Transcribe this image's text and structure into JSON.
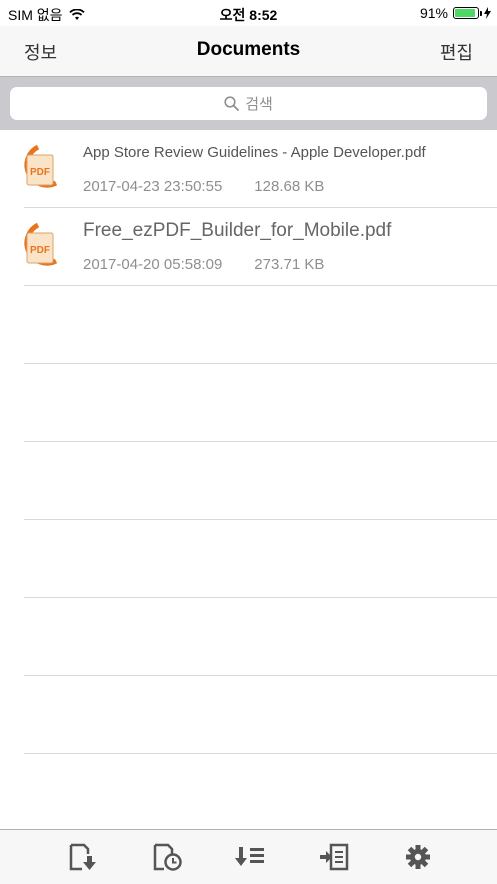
{
  "status": {
    "carrier": "SIM 없음",
    "time": "오전 8:52",
    "battery_percent": "91%",
    "battery_level": 0.91
  },
  "nav": {
    "left": "정보",
    "title": "Documents",
    "right": "편집"
  },
  "search": {
    "placeholder": "검색"
  },
  "files": [
    {
      "name": "App Store Review Guidelines - Apple Developer.pdf",
      "date": "2017-04-23 23:50:55",
      "size": "128.68 KB",
      "icon_text": "PDF"
    },
    {
      "name": "Free_ezPDF_Builder_for_Mobile.pdf",
      "date": "2017-04-20 05:58:09",
      "size": "273.71 KB",
      "icon_text": "PDF"
    }
  ],
  "toolbar": {
    "icons": [
      "download-document-icon",
      "recent-documents-icon",
      "sort-icon",
      "import-icon",
      "settings-gear-icon"
    ]
  },
  "colors": {
    "battery_fill": "#4cd964",
    "pdf_orange": "#e8761e",
    "icon_gray": "#555555"
  }
}
